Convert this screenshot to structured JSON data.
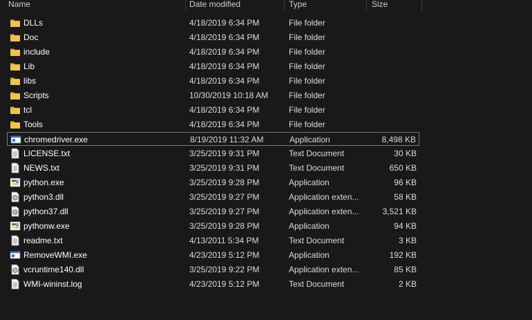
{
  "columns": {
    "name": "Name",
    "date_modified": "Date modified",
    "type": "Type",
    "size": "Size"
  },
  "files": [
    {
      "name": "DLLs",
      "date": "4/18/2019 6:34 PM",
      "type": "File folder",
      "size": "",
      "icon": "folder-icon"
    },
    {
      "name": "Doc",
      "date": "4/18/2019 6:34 PM",
      "type": "File folder",
      "size": "",
      "icon": "folder-icon"
    },
    {
      "name": "include",
      "date": "4/18/2019 6:34 PM",
      "type": "File folder",
      "size": "",
      "icon": "folder-icon"
    },
    {
      "name": "Lib",
      "date": "4/18/2019 6:34 PM",
      "type": "File folder",
      "size": "",
      "icon": "folder-icon"
    },
    {
      "name": "libs",
      "date": "4/18/2019 6:34 PM",
      "type": "File folder",
      "size": "",
      "icon": "folder-icon"
    },
    {
      "name": "Scripts",
      "date": "10/30/2019 10:18 AM",
      "type": "File folder",
      "size": "",
      "icon": "folder-icon"
    },
    {
      "name": "tcl",
      "date": "4/18/2019 6:34 PM",
      "type": "File folder",
      "size": "",
      "icon": "folder-icon"
    },
    {
      "name": "Tools",
      "date": "4/18/2019 6:34 PM",
      "type": "File folder",
      "size": "",
      "icon": "folder-icon"
    },
    {
      "name": "chromedriver.exe",
      "date": "8/19/2019 11:32 AM",
      "type": "Application",
      "size": "8,498 KB",
      "icon": "application-window-icon",
      "selected": true
    },
    {
      "name": "LICENSE.txt",
      "date": "3/25/2019 9:31 PM",
      "type": "Text Document",
      "size": "30 KB",
      "icon": "text-document-icon"
    },
    {
      "name": "NEWS.txt",
      "date": "3/25/2019 9:31 PM",
      "type": "Text Document",
      "size": "650 KB",
      "icon": "text-document-icon"
    },
    {
      "name": "python.exe",
      "date": "3/25/2019 9:28 PM",
      "type": "Application",
      "size": "96 KB",
      "icon": "python-app-icon"
    },
    {
      "name": "python3.dll",
      "date": "3/25/2019 9:27 PM",
      "type": "Application exten...",
      "size": "58 KB",
      "icon": "dll-gear-icon"
    },
    {
      "name": "python37.dll",
      "date": "3/25/2019 9:27 PM",
      "type": "Application exten...",
      "size": "3,521 KB",
      "icon": "dll-gear-icon"
    },
    {
      "name": "pythonw.exe",
      "date": "3/25/2019 9:28 PM",
      "type": "Application",
      "size": "94 KB",
      "icon": "python-app-icon"
    },
    {
      "name": "readme.txt",
      "date": "4/13/2011 5:34 PM",
      "type": "Text Document",
      "size": "3 KB",
      "icon": "text-document-icon"
    },
    {
      "name": "RemoveWMI.exe",
      "date": "4/23/2019 5:12 PM",
      "type": "Application",
      "size": "192 KB",
      "icon": "application-window-icon"
    },
    {
      "name": "vcruntime140.dll",
      "date": "3/25/2019 9:22 PM",
      "type": "Application exten...",
      "size": "85 KB",
      "icon": "dll-gear-icon"
    },
    {
      "name": "WMI-wininst.log",
      "date": "4/23/2019 5:12 PM",
      "type": "Text Document",
      "size": "2 KB",
      "icon": "text-document-icon"
    }
  ],
  "colors": {
    "background": "#191919",
    "folder": "#e8b94a",
    "selection_border": "#7a7a7a"
  }
}
